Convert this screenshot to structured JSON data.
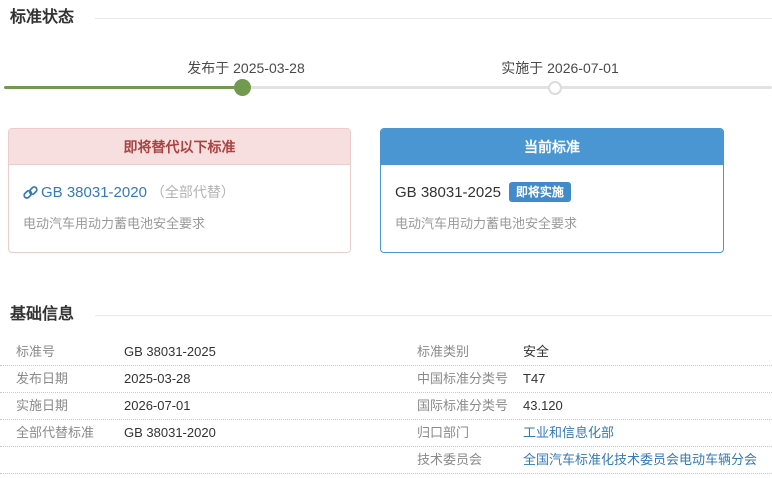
{
  "status_section": {
    "title": "标准状态",
    "timeline": {
      "published_label": "发布于 2025-03-28",
      "implemented_label": "实施于 2026-07-01"
    },
    "cards": {
      "replaced": {
        "title": "即将替代以下标准",
        "standard_code": "GB 38031-2020",
        "replace_note": "（全部代替）",
        "standard_name": "电动汽车用动力蓄电池安全要求"
      },
      "current": {
        "title": "当前标准",
        "standard_code": "GB 38031-2025",
        "badge": "即将实施",
        "standard_name": "电动汽车用动力蓄电池安全要求"
      }
    }
  },
  "info_section": {
    "title": "基础信息",
    "rows": [
      {
        "l1": "标准号",
        "v1": "GB 38031-2025",
        "l2": "标准类别",
        "v2": "安全"
      },
      {
        "l1": "发布日期",
        "v1": "2025-03-28",
        "l2": "中国标准分类号",
        "v2": "T47"
      },
      {
        "l1": "实施日期",
        "v1": "2026-07-01",
        "l2": "国际标准分类号",
        "v2": "43.120"
      },
      {
        "l1": "全部代替标准",
        "v1": "GB 38031-2020",
        "l2": "归口部门",
        "v2": "工业和信息化部"
      },
      {
        "l1": "",
        "v1": "",
        "l2": "技术委员会",
        "v2": "全国汽车标准化技术委员会电动车辆分会"
      }
    ]
  },
  "icons": {
    "link_icon": "chain-link"
  },
  "colors": {
    "timeline_done_green": "#71994f",
    "timeline_todo_gray": "#e2e2e2",
    "current_blue": "#4a96d2",
    "badge_blue": "#428bca",
    "link_blue": "#337ab7",
    "replaced_red_text": "#a94442",
    "replaced_pink_bg": "#f7dfdf",
    "replaced_pink_border": "#eccccc"
  }
}
